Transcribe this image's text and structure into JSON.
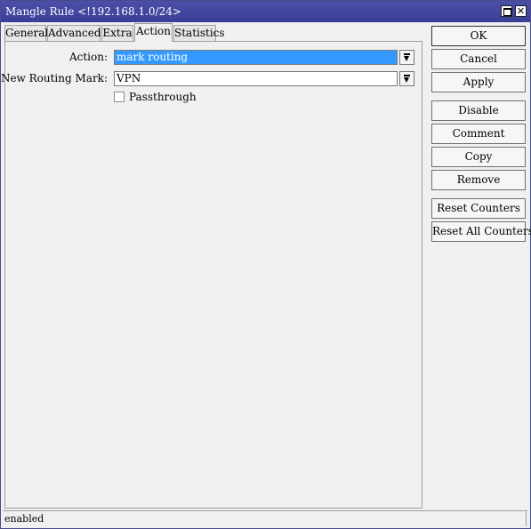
{
  "window": {
    "title": "Mangle Rule <!192.168.1.0/24>"
  },
  "tabs": [
    {
      "label": "General",
      "active": false
    },
    {
      "label": "Advanced",
      "active": false
    },
    {
      "label": "Extra",
      "active": false
    },
    {
      "label": "Action",
      "active": true
    },
    {
      "label": "Statistics",
      "active": false
    }
  ],
  "form": {
    "action": {
      "label": "Action:",
      "value": "mark routing"
    },
    "routing_mark": {
      "label": "New Routing Mark:",
      "value": "VPN"
    },
    "passthrough": {
      "label": "Passthrough",
      "checked": false
    }
  },
  "buttons": {
    "ok": "OK",
    "cancel": "Cancel",
    "apply": "Apply",
    "disable": "Disable",
    "comment": "Comment",
    "copy": "Copy",
    "remove": "Remove",
    "reset_counters": "Reset Counters",
    "reset_all_counters": "Reset All Counters"
  },
  "status": {
    "text": "enabled"
  },
  "colors": {
    "titlebar": "#3f43a0",
    "selection": "#3399ff"
  }
}
